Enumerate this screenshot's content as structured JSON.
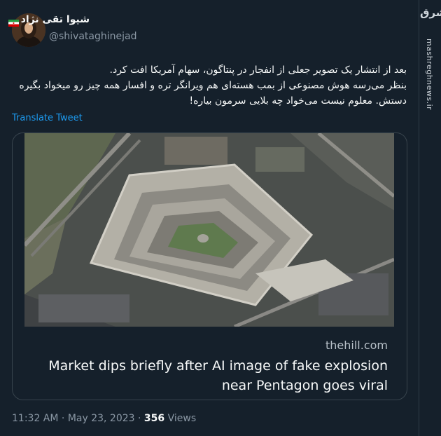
{
  "tweet": {
    "display_name": "شیوا تقی نژاد",
    "handle": "@shivataghinejad",
    "body_lines": [
      "بعد از انتشار یک تصویر جعلی از انفجار در پنتاگون، سهام آمریکا افت کرد.",
      "بنظر می‌رسه هوش مصنوعی از بمب هسته‌ای هم ویرانگر تره و افسار همه چیز رو میخواد بگیره",
      "دستش. معلوم نیست می‌خواد چه بلایی سرمون بیاره!"
    ],
    "translate_label": "Translate Tweet",
    "card": {
      "domain": "thehill.com",
      "headline_line1": "Market dips briefly after AI image of fake explosion",
      "headline_line2": "near Pentagon goes viral"
    },
    "time": "11:32 AM",
    "separator": "·",
    "date": "May 23, 2023",
    "views_count": "356",
    "views_label": "Views"
  },
  "watermark": {
    "logo_text": "مشرق",
    "url": "mashreghnews.ir"
  },
  "colors": {
    "background": "#15202b",
    "link": "#1d9bf0",
    "secondary_text": "#8b98a5"
  }
}
